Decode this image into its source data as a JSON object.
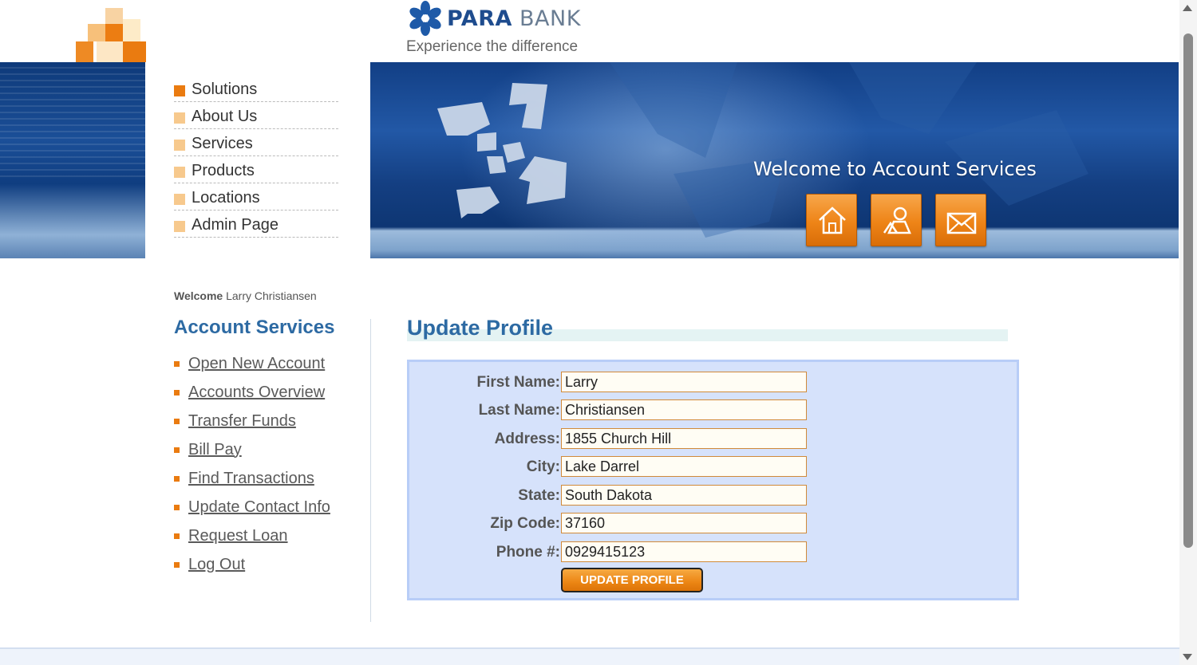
{
  "brand": {
    "name_part1": "PARA",
    "name_part2": "BANK",
    "tagline": "Experience the difference"
  },
  "top_menu": [
    {
      "label": "Solutions"
    },
    {
      "label": "About Us"
    },
    {
      "label": "Services"
    },
    {
      "label": "Products"
    },
    {
      "label": "Locations"
    },
    {
      "label": "Admin Page"
    }
  ],
  "header": {
    "welcome_title": "Welcome to Account Services",
    "buttons": [
      {
        "icon": "home-icon"
      },
      {
        "icon": "about-icon"
      },
      {
        "icon": "contact-icon"
      }
    ]
  },
  "sidebar": {
    "welcome_label": "Welcome",
    "user_name": "Larry Christiansen",
    "title": "Account Services",
    "links": [
      {
        "label": "Open New Account"
      },
      {
        "label": "Accounts Overview"
      },
      {
        "label": "Transfer Funds"
      },
      {
        "label": "Bill Pay"
      },
      {
        "label": "Find Transactions"
      },
      {
        "label": "Update Contact Info"
      },
      {
        "label": "Request Loan"
      },
      {
        "label": "Log Out"
      }
    ]
  },
  "main": {
    "title": "Update Profile",
    "fields": [
      {
        "label": "First Name:",
        "value": "Larry"
      },
      {
        "label": "Last Name:",
        "value": "Christiansen"
      },
      {
        "label": "Address:",
        "value": "1855 Church Hill"
      },
      {
        "label": "City:",
        "value": "Lake Darrel"
      },
      {
        "label": "State:",
        "value": "South Dakota"
      },
      {
        "label": "Zip Code:",
        "value": "37160"
      },
      {
        "label": "Phone #:",
        "value": "0929415123"
      }
    ],
    "submit_label": "UPDATE PROFILE"
  },
  "colors": {
    "accent_orange": "#ea7b10",
    "heading_blue": "#2d6aa3",
    "form_bg": "#d6e2fb"
  }
}
